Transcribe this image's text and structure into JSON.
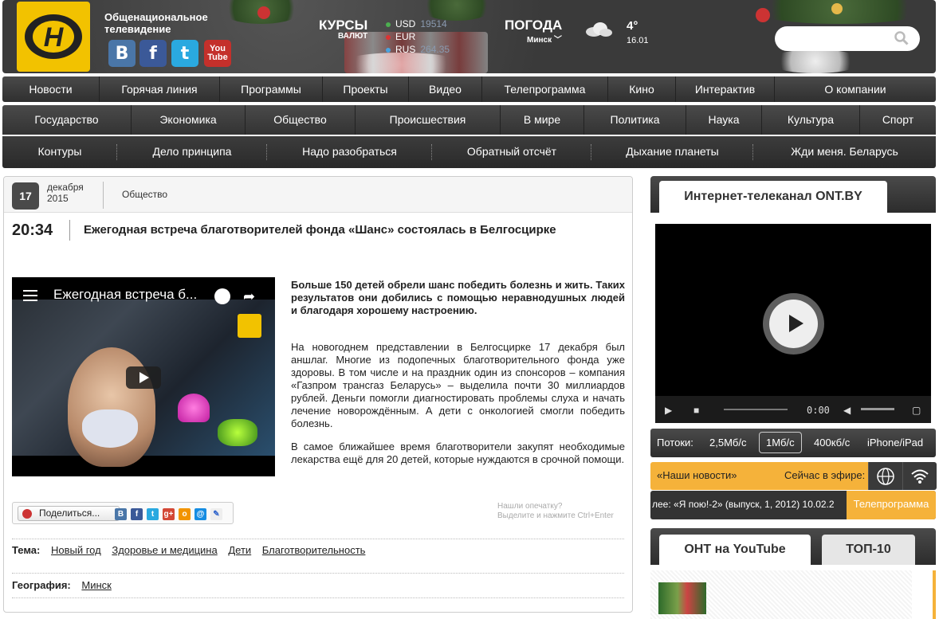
{
  "header": {
    "brand": "Общенациональное телевидение",
    "social": [
      {
        "name": "vk",
        "glyph": "В",
        "color": "#4a76a8"
      },
      {
        "name": "facebook",
        "glyph": "f",
        "color": "#3b5998"
      },
      {
        "name": "twitter",
        "glyph": "t",
        "color": "#2aa9e0"
      },
      {
        "name": "youtube",
        "glyph": "You Tube",
        "color": "#c4302b"
      }
    ],
    "kursy_title": "КУРСЫ",
    "kursy_sub": "ВАЛЮТ",
    "currencies": [
      {
        "code": "USD",
        "value": "19514",
        "dot": "#4caf50"
      },
      {
        "code": "EUR",
        "value": "",
        "dot": "#d33"
      },
      {
        "code": "RUS",
        "value": "264.35",
        "dot": "#4aa3df"
      }
    ],
    "pogoda_title": "ПОГОДА",
    "city": "Минск",
    "temperature": "4°",
    "weather_date": "16.01",
    "search_placeholder": ""
  },
  "nav_main": [
    "Новости",
    "Горячая линия",
    "Программы",
    "Проекты",
    "Видео",
    "Телепрограмма",
    "Кино",
    "Интерактив",
    "О компании"
  ],
  "nav_categories": [
    "Государство",
    "Экономика",
    "Общество",
    "Происшествия",
    "В мире",
    "Политика",
    "Наука",
    "Культура",
    "Спорт"
  ],
  "nav_programs": [
    "Контуры",
    "Дело принципа",
    "Надо разобраться",
    "Обратный отсчёт",
    "Дыхание планеты",
    "Жди меня. Беларусь"
  ],
  "article": {
    "day": "17",
    "month": "декабря",
    "year": "2015",
    "category": "Общество",
    "time": "20:34",
    "title": "Ежегодная встреча благотворителей фонда «Шанс» состоялась в Белгосцирке",
    "video_title": "Ежегодная встреча б...",
    "lead": "Больше 150 детей обрели шанс победить болезнь и жить. Таких результатов они добились с помощью неравнодушных людей и благодаря хорошему настроению.",
    "paragraphs": [
      "На новогоднем представлении в Белгосцирке 17 декабря был аншлаг. Многие из подопечных благотворительного фонда уже здоровы. В том числе и на праздник один из спонсоров – компания «Газпром трансгаз Беларусь» – выделила почти 30 миллиардов рублей. Деньги помогли диагностировать проблемы слуха и начать лечение новорождённым. А дети с онкологией смогли победить болезнь.",
      "В самое ближайшее время благотворители закупят необходимые лекарства ещё для 20 детей, которые нуждаются в срочной помощи."
    ],
    "share_label": "Поделиться...",
    "typo_line1": "Нашли опечатку?",
    "typo_line2": "Выделите и нажмите Ctrl+Enter",
    "tags_label": "Тема:",
    "tags": [
      "Новый год",
      "Здоровье и медицина",
      "Дети",
      "Благотворительность"
    ],
    "geo_label": "География:",
    "geo": "Минск"
  },
  "sidebar": {
    "channel_tab": "Интернет-телеканал ONT.BY",
    "player_time": "0:00",
    "streams_label": "Потоки:",
    "streams": [
      "2,5Мб/с",
      "1Мб/с",
      "400кб/с",
      "iPhone/iPad"
    ],
    "streams_selected": "1Мб/с",
    "onair_show": "«Наши новости»",
    "onair_label": "Сейчас в эфире:",
    "ticker": "лее: «Я пою!-2» (выпуск, 1, 2012) 10.02.2",
    "tv_program": "Телепрограмма",
    "yt_tab": "ОНТ на YouTube",
    "top_tab": "ТОП-10"
  }
}
